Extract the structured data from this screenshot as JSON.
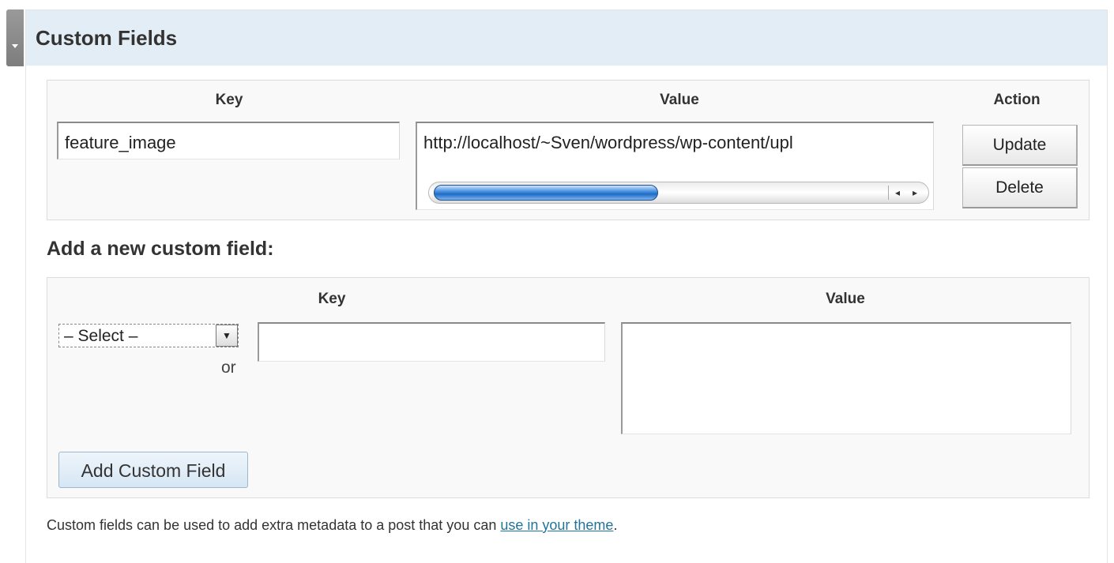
{
  "panel": {
    "title": "Custom Fields"
  },
  "existing": {
    "headers": {
      "key": "Key",
      "value": "Value",
      "action": "Action"
    },
    "key_value": "feature_image",
    "value_text": "http://localhost/~Sven/wordpress/wp-content/upl",
    "scroll_position_fraction": 0.5,
    "update_label": "Update",
    "delete_label": "Delete"
  },
  "new_field": {
    "heading": "Add a new custom field:",
    "headers": {
      "key": "Key",
      "value": "Value"
    },
    "select_value": "– Select –",
    "or_label": "or",
    "key_value": "",
    "value_text": "",
    "add_label": "Add Custom Field"
  },
  "footer": {
    "text": "Custom fields can be used to add extra metadata to a post that you can ",
    "link": "use in your theme",
    "period": "."
  },
  "colors": {
    "header_bg": "#e3edf6",
    "link": "#21759b",
    "scroll_thumb": "#1f6bc6"
  }
}
